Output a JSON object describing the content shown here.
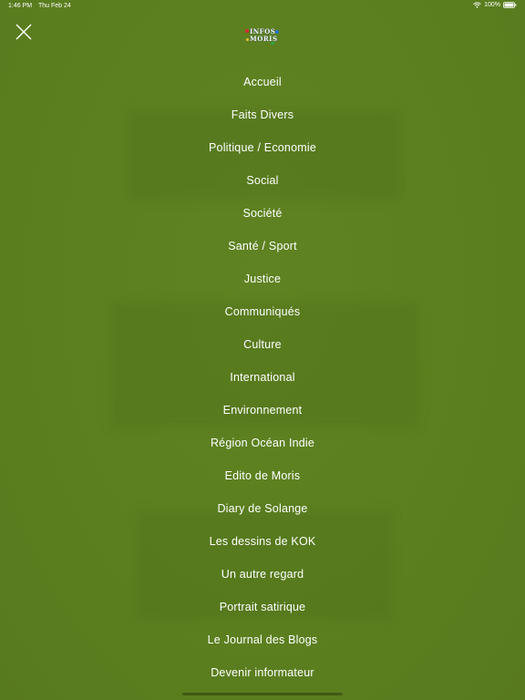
{
  "status_bar": {
    "time": "1:46 PM",
    "date": "Thu Feb 24",
    "battery": "100%"
  },
  "logo": {
    "line1": "INFOS",
    "line2": "MORIS"
  },
  "menu": {
    "items": [
      "Accueil",
      "Faits Divers",
      "Politique / Economie",
      "Social",
      "Société",
      "Santé / Sport",
      "Justice",
      "Communiqués",
      "Culture",
      "International",
      "Environnement",
      "Région Océan Indie",
      "Edito de Moris",
      "Diary de Solange",
      "Les dessins de KOK",
      "Un autre regard",
      "Portrait satirique",
      "Le Journal des Blogs",
      "Devenir informateur"
    ]
  },
  "colors": {
    "background": "#5b7f1f",
    "text": "#ffffff",
    "home_indicator": "#3f5a14"
  },
  "icons": {
    "close": "close-icon",
    "wifi": "wifi-icon",
    "battery": "battery-icon"
  }
}
